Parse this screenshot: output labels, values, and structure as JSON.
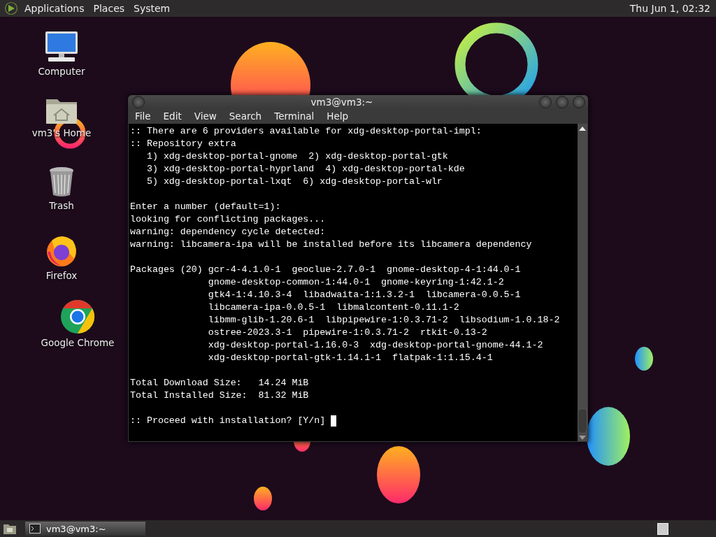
{
  "top_panel": {
    "menus": [
      "Applications",
      "Places",
      "System"
    ],
    "clock": "Thu Jun 1, 02:32"
  },
  "desktop_icons": [
    {
      "kind": "computer",
      "label": "Computer"
    },
    {
      "kind": "home",
      "label": "vm3's Home"
    },
    {
      "kind": "trash",
      "label": "Trash"
    },
    {
      "kind": "firefox",
      "label": "Firefox"
    },
    {
      "kind": "chrome",
      "label": "Google Chrome"
    }
  ],
  "terminal": {
    "title": "vm3@vm3:~",
    "menu": [
      "File",
      "Edit",
      "View",
      "Search",
      "Terminal",
      "Help"
    ],
    "paragraphs": [
      [
        ":: There are 6 providers available for xdg-desktop-portal-impl:",
        ":: Repository extra",
        "   1) xdg-desktop-portal-gnome  2) xdg-desktop-portal-gtk",
        "   3) xdg-desktop-portal-hyprland  4) xdg-desktop-portal-kde",
        "   5) xdg-desktop-portal-lxqt  6) xdg-desktop-portal-wlr"
      ],
      [
        "Enter a number (default=1):",
        "looking for conflicting packages...",
        "warning: dependency cycle detected:",
        "warning: libcamera-ipa will be installed before its libcamera dependency"
      ],
      [
        "Packages (20) gcr-4-4.1.0-1  geoclue-2.7.0-1  gnome-desktop-4-1:44.0-1",
        "              gnome-desktop-common-1:44.0-1  gnome-keyring-1:42.1-2",
        "              gtk4-1:4.10.3-4  libadwaita-1:1.3.2-1  libcamera-0.0.5-1",
        "              libcamera-ipa-0.0.5-1  libmalcontent-0.11.1-2",
        "              libmm-glib-1.20.6-1  libpipewire-1:0.3.71-2  libsodium-1.0.18-2",
        "              ostree-2023.3-1  pipewire-1:0.3.71-2  rtkit-0.13-2",
        "              xdg-desktop-portal-1.16.0-3  xdg-desktop-portal-gnome-44.1-2",
        "              xdg-desktop-portal-gtk-1.14.1-1  flatpak-1:1.15.4-1"
      ],
      [
        "Total Download Size:   14.24 MiB",
        "Total Installed Size:  81.32 MiB"
      ],
      [
        ":: Proceed with installation? [Y/n] "
      ]
    ]
  },
  "taskbar": {
    "tasks": [
      {
        "label": "vm3@vm3:~",
        "selected": true
      }
    ]
  }
}
